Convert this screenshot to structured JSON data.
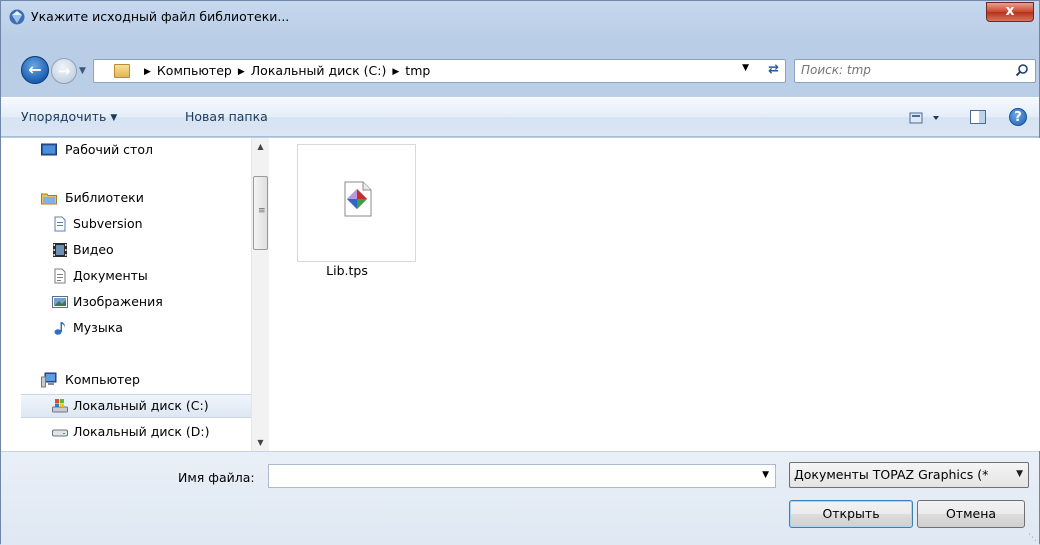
{
  "window": {
    "title": "Укажите исходный файл библиотеки...",
    "close_label": "x"
  },
  "address": {
    "crumbs": [
      "Компьютер",
      "Локальный диск (C:)",
      "tmp"
    ],
    "search_placeholder": "Поиск: tmp"
  },
  "toolbar": {
    "organize_label": "Упорядочить",
    "new_folder_label": "Новая папка",
    "help_label": "?"
  },
  "nav": {
    "items": [
      {
        "label": "Рабочий стол",
        "icon": "desktop-icon"
      },
      {
        "label": "Библиотеки",
        "icon": "libraries-icon"
      },
      {
        "label": "Subversion",
        "icon": "document-icon"
      },
      {
        "label": "Видео",
        "icon": "video-icon"
      },
      {
        "label": "Документы",
        "icon": "documents-icon"
      },
      {
        "label": "Изображения",
        "icon": "pictures-icon"
      },
      {
        "label": "Музыка",
        "icon": "music-icon"
      },
      {
        "label": "Компьютер",
        "icon": "computer-icon"
      },
      {
        "label": "Локальный диск (C:)",
        "icon": "system-drive-icon",
        "selected": true
      },
      {
        "label": "Локальный диск (D:)",
        "icon": "drive-icon"
      }
    ]
  },
  "files": [
    {
      "name": "Lib.tps",
      "icon": "topaz-file-icon"
    }
  ],
  "bottom": {
    "filename_label": "Имя файла:",
    "filename_value": "",
    "filetype_value": "Документы TOPAZ Graphics (*",
    "open_label": "Открыть",
    "cancel_label": "Отмена"
  },
  "colors": {
    "accent": "#1c5fb2",
    "selection": "#dde7f3",
    "close": "#c9462c"
  }
}
